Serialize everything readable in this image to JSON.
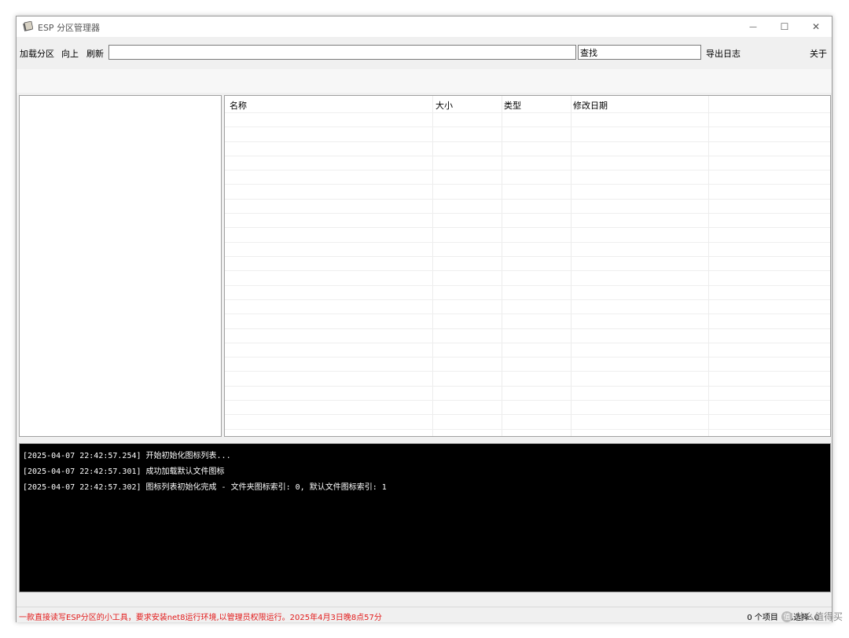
{
  "window": {
    "title": "ESP 分区管理器",
    "minimize_glyph": "—",
    "maximize_glyph": "☐",
    "close_glyph": "✕"
  },
  "toolbar": {
    "load_partition": "加载分区",
    "up": "向上",
    "refresh": "刷新",
    "path_value": "",
    "search_value": "查找",
    "export_log": "导出日志",
    "about": "关于"
  },
  "list": {
    "columns": [
      "名称",
      "大小",
      "类型",
      "修改日期"
    ]
  },
  "log": {
    "lines": [
      "[2025-04-07 22:42:57.254] 开始初始化图标列表...",
      "[2025-04-07 22:42:57.301] 成功加载默认文件图标",
      "[2025-04-07 22:42:57.302] 图标列表初始化完成 - 文件夹图标索引: 0, 默认文件图标索引: 1"
    ]
  },
  "status": {
    "message": "一款直接读写ESP分区的小工具，要求安装net8运行环境,以管理员权限运行。2025年4月3日晚8点57分",
    "items": "0 个项目",
    "selected": "已选择: 0"
  },
  "watermark": {
    "badge": "值",
    "text": "什么值得买"
  },
  "colors": {
    "status_message": "#e21b1b",
    "log_background": "#000000",
    "log_text": "#ffffff"
  }
}
